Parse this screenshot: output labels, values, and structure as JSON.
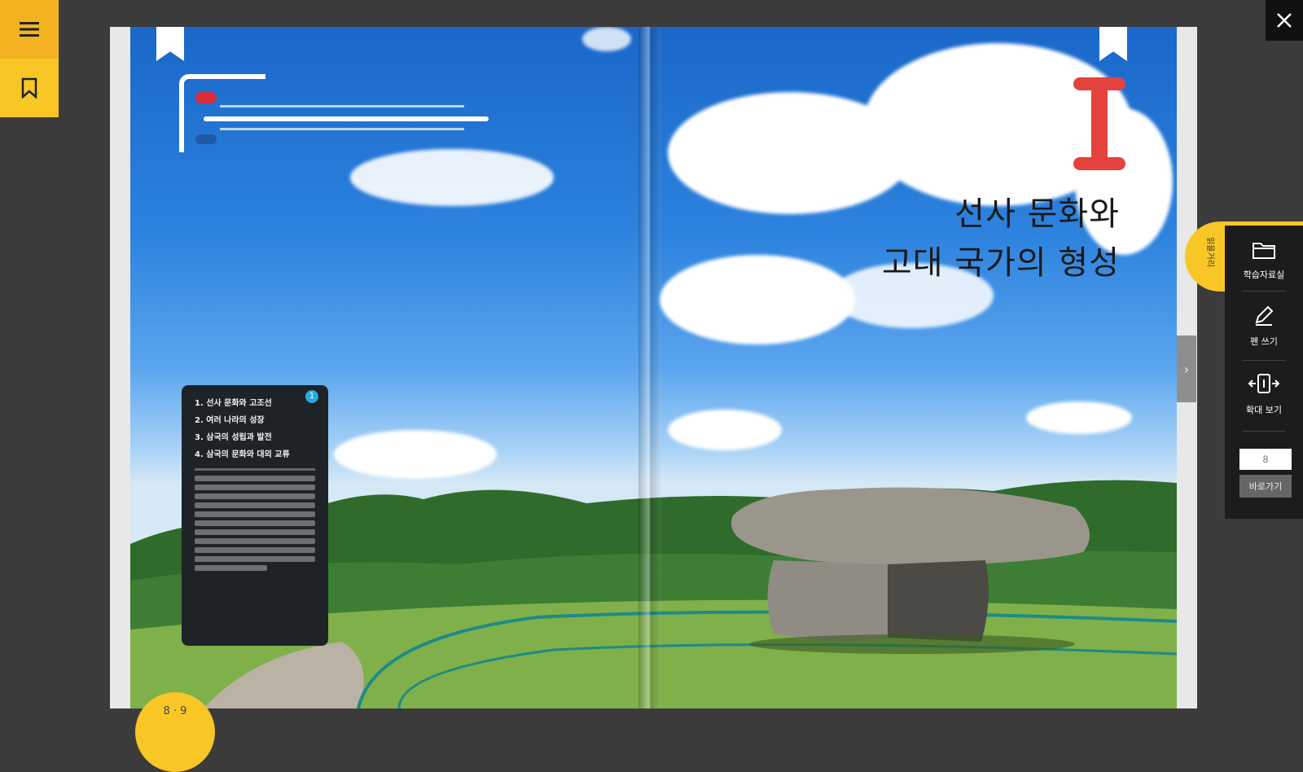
{
  "toolbar": {
    "menu_icon": "hamburger-icon",
    "bookmark_icon": "bookmark-icon",
    "close_icon": "close-icon"
  },
  "chapter": {
    "number": "I",
    "title_line1": "선사 문화와",
    "title_line2": "고대 국가의 형성"
  },
  "toc": {
    "badge": "1",
    "items": [
      "1. 선사 문화와 고조선",
      "2. 여러 나라의 성장",
      "3. 삼국의 성립과 발전",
      "4. 삼국의 문화와 대외 교류"
    ]
  },
  "page_indicator": "8 · 9",
  "side_panel": {
    "tab_label": "읽을거리",
    "tools": [
      {
        "label": "학습자료실",
        "icon": "folder-icon"
      },
      {
        "label": "펜 쓰기",
        "icon": "pencil-icon"
      },
      {
        "label": "확대 보기",
        "icon": "zoom-icon"
      }
    ],
    "goto_placeholder": "8",
    "goto_button": "바로가기"
  },
  "colors": {
    "accent_yellow": "#f8c726",
    "chapter_red": "#e5413d"
  }
}
